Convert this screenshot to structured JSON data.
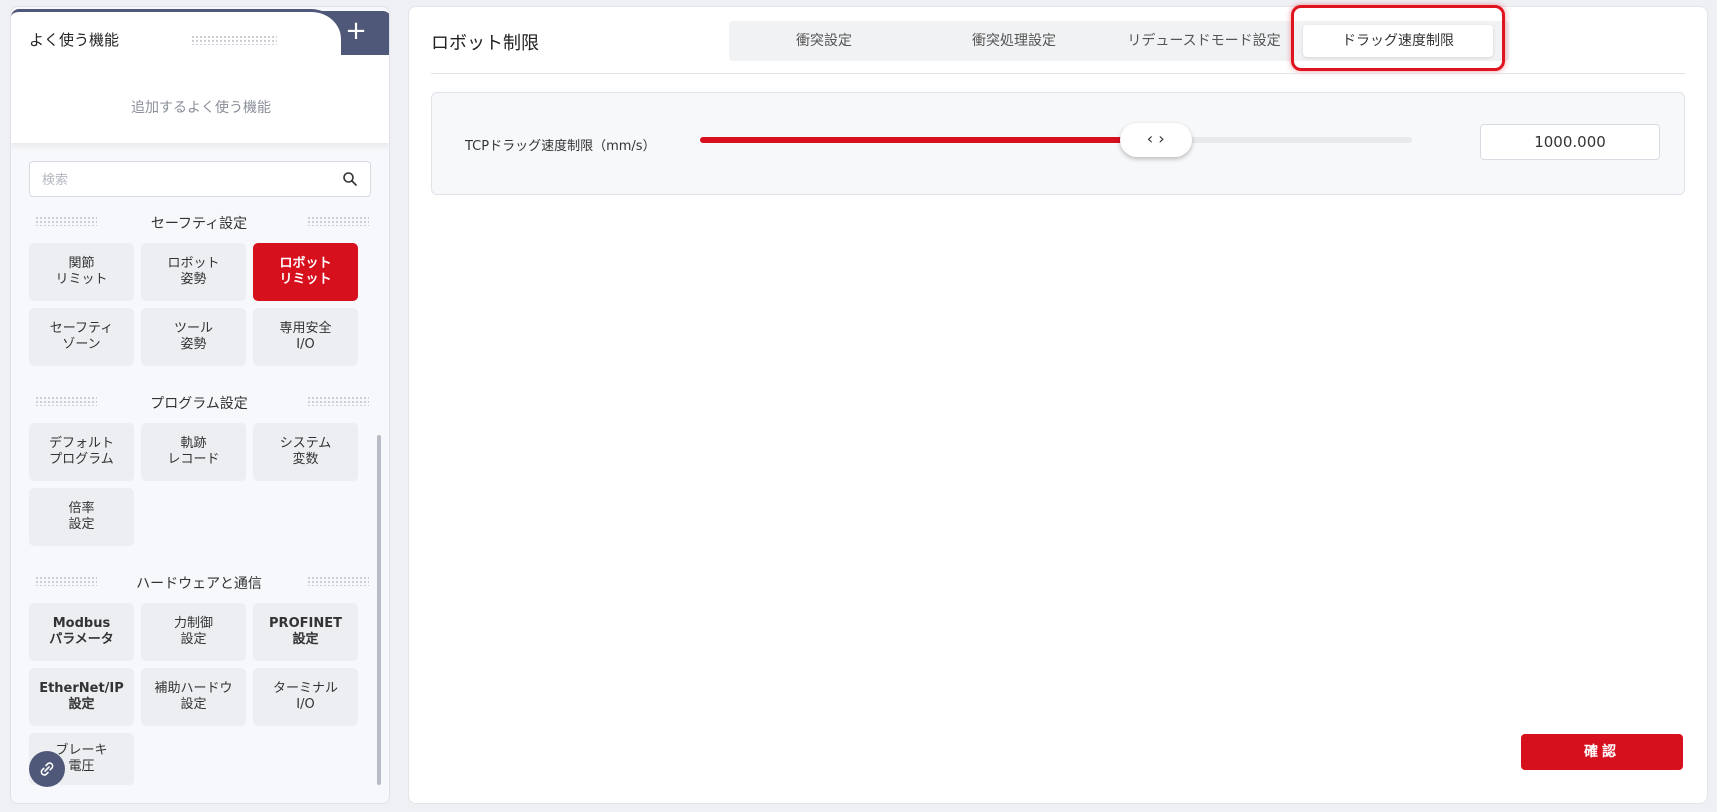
{
  "favorites": {
    "title": "よく使う機能",
    "add_label": "+",
    "empty_text": "追加するよく使う機能"
  },
  "search": {
    "placeholder": "検索",
    "value": ""
  },
  "sections": [
    {
      "title": "セーフティ設定",
      "items": [
        "関節\nリミット",
        "ロボット\n姿勢",
        "ロボット\nリミット",
        "セーフティ\nゾーン",
        "ツール\n姿勢",
        "専用安全\nI/O"
      ],
      "active_index": 2
    },
    {
      "title": "プログラム設定",
      "items": [
        "デフォルト\nプログラム",
        "軌跡\nレコード",
        "システム\n変数",
        "倍率\n設定"
      ]
    },
    {
      "title": "ハードウェアと通信",
      "items": [
        "Modbus\nパラメータ",
        "力制御\n設定",
        "PROFINET\n設定",
        "EtherNet/IP\n設定",
        "補助ハードウ\n設定",
        "ターミナル\nI/O",
        "ブレーキ\n電圧"
      ]
    }
  ],
  "main": {
    "title": "ロボット制限",
    "tabs": [
      "衝突設定",
      "衝突処理設定",
      "リデュースドモード設定",
      "ドラッグ速度制限"
    ],
    "active_tab": 3,
    "setting": {
      "label": "TCPドラッグ速度制限（mm/s）",
      "value": "1000.000",
      "slider_fraction": 0.64,
      "thumb_glyph": "‹ ›"
    },
    "confirm_label": "確認"
  },
  "colors": {
    "accent": "#d7101e",
    "nav_dark": "#4f5878"
  },
  "icons": {
    "search": "search-icon",
    "float": "link-icon"
  }
}
